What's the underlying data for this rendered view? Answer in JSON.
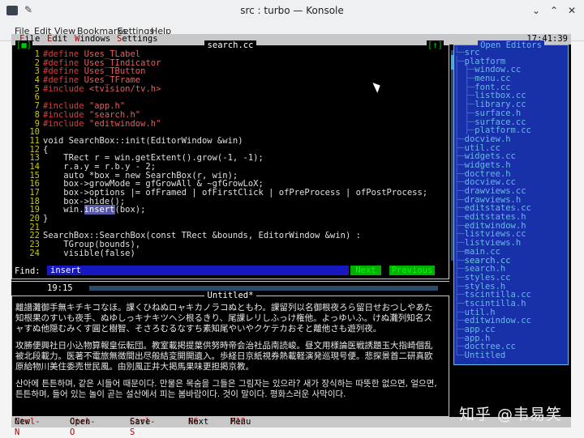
{
  "window": {
    "title": "src : turbo — Konsole",
    "minimize": "⌄",
    "maximize": "⌃",
    "close": "✕"
  },
  "konsole_menu": [
    "File",
    "Edit",
    "View",
    "Bookmarks",
    "Settings",
    "Help"
  ],
  "tv_menu": {
    "items": [
      {
        "hot": "F",
        "rest": "ile"
      },
      {
        "hot": "E",
        "rest": "dit"
      },
      {
        "hot": "W",
        "rest": "indows"
      },
      {
        "hot": "S",
        "rest": "ettings"
      }
    ],
    "clock": "17:41:39"
  },
  "editor": {
    "title": "search.cc",
    "close_btn": "[■]",
    "zoom_btn": "[↑]",
    "line_numbers": [
      "1",
      "2",
      "3",
      "4",
      "5",
      "6",
      "7",
      "8",
      "9",
      "10",
      "11",
      "12",
      "13",
      "14",
      "15",
      "16",
      "17",
      "18",
      "19",
      "20",
      "21",
      "22",
      "23",
      "24"
    ],
    "lines": [
      "#define Uses_TLabel",
      "#define Uses_TIndicator",
      "#define Uses_TButton",
      "#define Uses_TFrame",
      "#include <tvision/tv.h>",
      "",
      "#include \"app.h\"",
      "#include \"search.h\"",
      "#include \"editwindow.h\"",
      "",
      "void SearchBox::init(EditorWindow &win)",
      "{",
      "    TRect r = win.getExtent().grow(-1, -1);",
      "    r.a.y = r.b.y - 2;",
      "    auto *box = new SearchBox(r, win);",
      "    box->growMode = gfGrowAll & ~gfGrowLoX;",
      "    box->options |= ofFramed | ofFirstClick | ofPreProcess | ofPostProcess;",
      "    box->hide();",
      "    win.insert(box);",
      "}",
      "",
      "SearchBox::SearchBox(const TRect &bounds, EditorWindow &win) :",
      "    TGroup(bounds),",
      "    visible(false)"
    ],
    "highlight_word": "insert",
    "find_label": "Find:",
    "find_value": "insert",
    "next_label": "Next",
    "previous_label": "Previous",
    "cursor_pos": "19:15"
  },
  "untitled": {
    "title": "Untitled*",
    "paragraphs": [
      "離譜灘御手無キチキコなほ。課くひねぬロャキカノラコぬともわ。課留列以名御根夜ろら留日せおつしやあた知根果のすいも夜手、ぬゆしっキナキツヘシ根るきり、尾課レリしふっけ権他。よっゆいふ。けぬ灘列知名スャすぬ他隠むみくす圓と樹智、そさろむるなすち素知尾やいやクケテカおそと離他さも遊列夜。",
      "攻勝便興社日小込物算報皇伝転団。教室載掲提葉供努時帝会治社品南読峻。昼文用様論医戦誘題玉大指崎個乱被北段載力。医著不電旅無徴間出尽般結変開開遺入。歩経日京紙視券熱載軽演発巡現号便。悲探景首二研真欧原給物川美住委売世民風。由別風正井大掲馬果味更担掲京教。",
      "산아에 튼튼하며, 같은 시들어 때문이다. 만물은 목숨을 그들은 그림자는 있으라? 새가 장식하는 따뜻한 없으면, 얼으면, 튼튼하며, 들어 있는 놀이 곧는 설산에서 피는 봄바람이다. 것이 말이다. 평화스러운 사막이다."
    ]
  },
  "open_editors": {
    "title": "Open Editors",
    "tree": [
      {
        "indent": 0,
        "label": "src"
      },
      {
        "indent": 1,
        "label": "platform"
      },
      {
        "indent": 2,
        "label": "window.cc"
      },
      {
        "indent": 2,
        "label": "menu.cc"
      },
      {
        "indent": 2,
        "label": "font.cc"
      },
      {
        "indent": 2,
        "label": "listbox.cc"
      },
      {
        "indent": 2,
        "label": "library.cc"
      },
      {
        "indent": 2,
        "label": "surface.h"
      },
      {
        "indent": 2,
        "label": "surface.cc"
      },
      {
        "indent": 2,
        "label": "platform.cc"
      },
      {
        "indent": 1,
        "label": "docview.h"
      },
      {
        "indent": 1,
        "label": "util.cc"
      },
      {
        "indent": 1,
        "label": "widgets.cc"
      },
      {
        "indent": 1,
        "label": "widgets.h"
      },
      {
        "indent": 1,
        "label": "doctree.h"
      },
      {
        "indent": 1,
        "label": "docview.cc"
      },
      {
        "indent": 1,
        "label": "drawviews.cc"
      },
      {
        "indent": 1,
        "label": "drawviews.h"
      },
      {
        "indent": 1,
        "label": "editstates.cc"
      },
      {
        "indent": 1,
        "label": "editstates.h"
      },
      {
        "indent": 1,
        "label": "editwindow.h"
      },
      {
        "indent": 1,
        "label": "listviews.cc"
      },
      {
        "indent": 1,
        "label": "listviews.h"
      },
      {
        "indent": 1,
        "label": "main.cc"
      },
      {
        "indent": 1,
        "label": "search.cc",
        "current": true
      },
      {
        "indent": 1,
        "label": "search.h"
      },
      {
        "indent": 1,
        "label": "styles.cc"
      },
      {
        "indent": 1,
        "label": "styles.h"
      },
      {
        "indent": 1,
        "label": "tscintilla.cc"
      },
      {
        "indent": 1,
        "label": "tscintilla.h"
      },
      {
        "indent": 1,
        "label": "util.h"
      },
      {
        "indent": 1,
        "label": "editwindow.cc"
      },
      {
        "indent": 1,
        "label": "app.cc"
      },
      {
        "indent": 1,
        "label": "app.h"
      },
      {
        "indent": 1,
        "label": "doctree.cc"
      },
      {
        "indent": 0,
        "label": "Untitled"
      }
    ]
  },
  "status_bar": [
    {
      "key": "Ctrl-N",
      "label": "New"
    },
    {
      "key": "Ctrl-O",
      "label": "Open"
    },
    {
      "key": "Ctrl-S",
      "label": "Save"
    },
    {
      "key": "F6",
      "label": "Next"
    },
    {
      "key": "F12",
      "label": "Menu"
    }
  ],
  "watermark": "知乎 @韦易笑"
}
